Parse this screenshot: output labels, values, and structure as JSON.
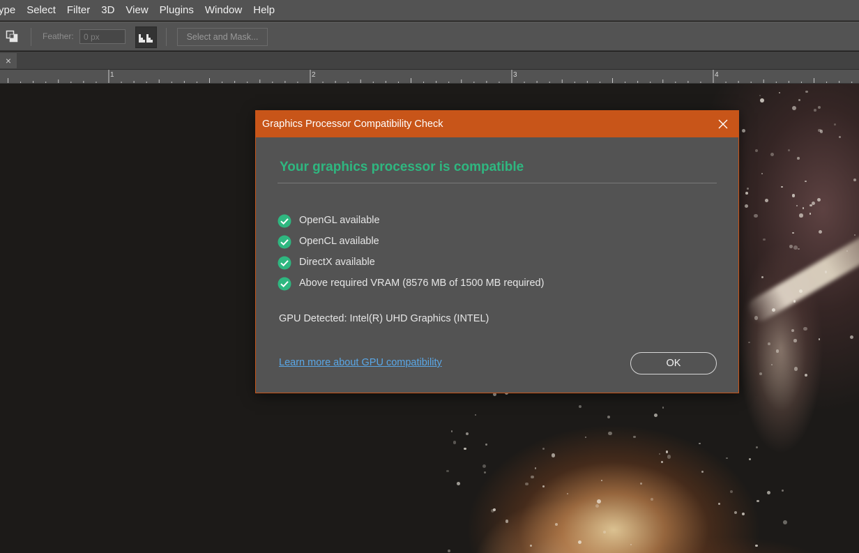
{
  "menubar": {
    "items": [
      "ype",
      "Select",
      "Filter",
      "3D",
      "View",
      "Plugins",
      "Window",
      "Help"
    ]
  },
  "options": {
    "feather_label": "Feather:",
    "feather_value": "0 px",
    "select_and_mask_label": "Select and Mask..."
  },
  "tab": {
    "close_glyph": "×"
  },
  "ruler": {
    "labels": [
      "1",
      "2",
      "3",
      "4"
    ]
  },
  "dialog": {
    "title": "Graphics Processor Compatibility Check",
    "headline": "Your graphics processor is compatible",
    "checks": [
      "OpenGL available",
      "OpenCL available",
      "DirectX available",
      "Above required VRAM (8576 MB of 1500 MB required)"
    ],
    "gpu_detected": "GPU Detected: Intel(R) UHD Graphics (INTEL)",
    "learn_more": "Learn more about GPU compatibility",
    "ok_label": "OK",
    "accent_color": "#c85519",
    "success_color": "#2fb780"
  }
}
